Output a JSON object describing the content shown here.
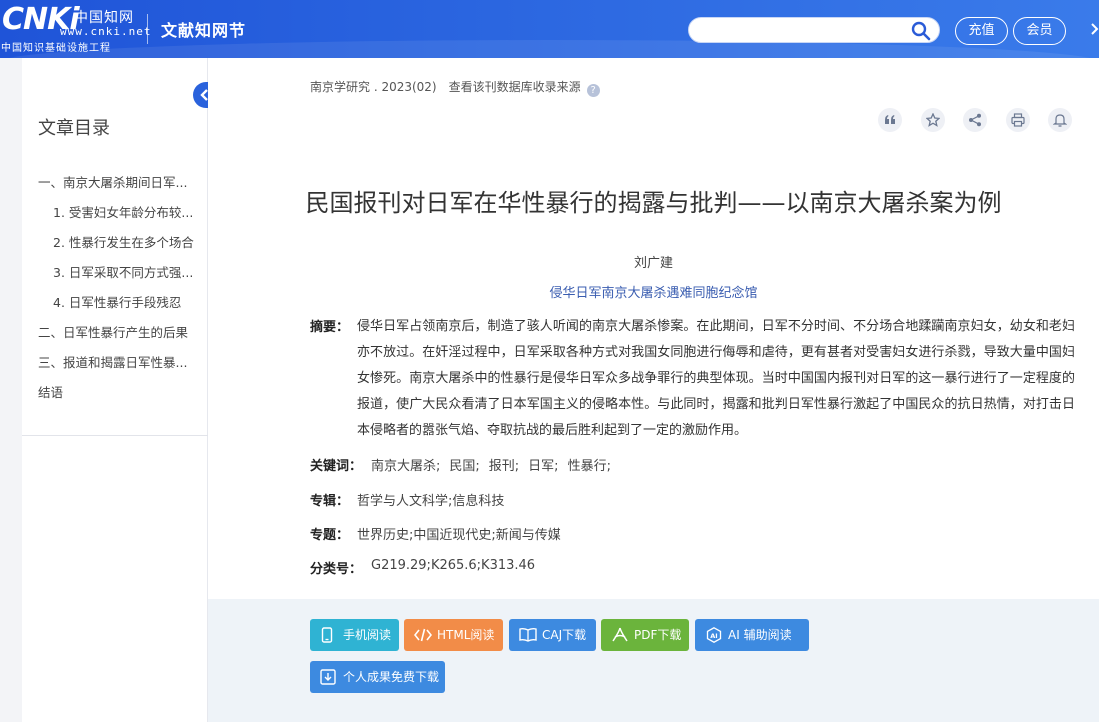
{
  "header": {
    "logo_text": "CNKi",
    "logo_cn": "中国知网",
    "logo_url": "www.cnki.net",
    "logo_project": "中国知识基础设施工程",
    "site_title": "文献知网节",
    "search_placeholder": "",
    "recharge_label": "充值",
    "member_label": "会员"
  },
  "sidebar": {
    "toc_title": "文章目录",
    "items": [
      "一、南京大屠杀期间日军...",
      "1. 受害妇女年龄分布较...",
      "2. 性暴行发生在多个场合",
      "3. 日军采取不同方式强...",
      "4. 日军性暴行手段残忍",
      "二、日军性暴行产生的后果",
      "三、报道和揭露日军性暴...",
      "结语"
    ]
  },
  "article": {
    "source": "南京学研究 . 2023(02)",
    "source_link": "查看该刊数据库收录来源",
    "title": "民国报刊对日军在华性暴行的揭露与批判——以南京大屠杀案为例",
    "author": "刘广建",
    "affiliation": "侵华日军南京大屠杀遇难同胞纪念馆",
    "abstract_label": "摘要：",
    "abstract": "侵华日军占领南京后，制造了骇人听闻的南京大屠杀惨案。在此期间，日军不分时间、不分场合地蹂躏南京妇女，幼女和老妇亦不放过。在奸淫过程中，日军采取各种方式对我国女同胞进行侮辱和虐待，更有甚者对受害妇女进行杀戮，导致大量中国妇女惨死。南京大屠杀中的性暴行是侵华日军众多战争罪行的典型体现。当时中国国内报刊对日军的这一暴行进行了一定程度的报道，使广大民众看清了日本军国主义的侵略本性。与此同时，揭露和批判日军性暴行激起了中国民众的抗日热情，对打击日本侵略者的嚣张气焰、夺取抗战的最后胜利起到了一定的激励作用。",
    "keywords_label": "关键词：",
    "keywords": [
      "南京大屠杀;",
      "民国;",
      "报刊;",
      "日军;",
      "性暴行;"
    ],
    "series_label": "专辑：",
    "series": "哲学与人文科学;信息科技",
    "topic_label": "专题：",
    "topic": "世界历史;中国近现代史;新闻与传媒",
    "class_label": "分类号：",
    "class_no": "G219.29;K265.6;K313.46"
  },
  "tools": [
    "quote-icon",
    "star-icon",
    "share-icon",
    "print-icon",
    "bell-icon"
  ],
  "actions": {
    "mobile": "手机阅读",
    "html": "HTML阅读",
    "caj": "CAJ下载",
    "pdf": "PDF下载",
    "ai": "AI 辅助阅读",
    "personal": "个人成果免费下载"
  },
  "colors": {
    "header_blue": "#2b66e0",
    "mobile": "#2fb3d3",
    "html": "#f28c48",
    "caj": "#3d8ae0",
    "pdf": "#6bb43c",
    "ai": "#3d8ae0",
    "personal": "#3d8ae0"
  }
}
